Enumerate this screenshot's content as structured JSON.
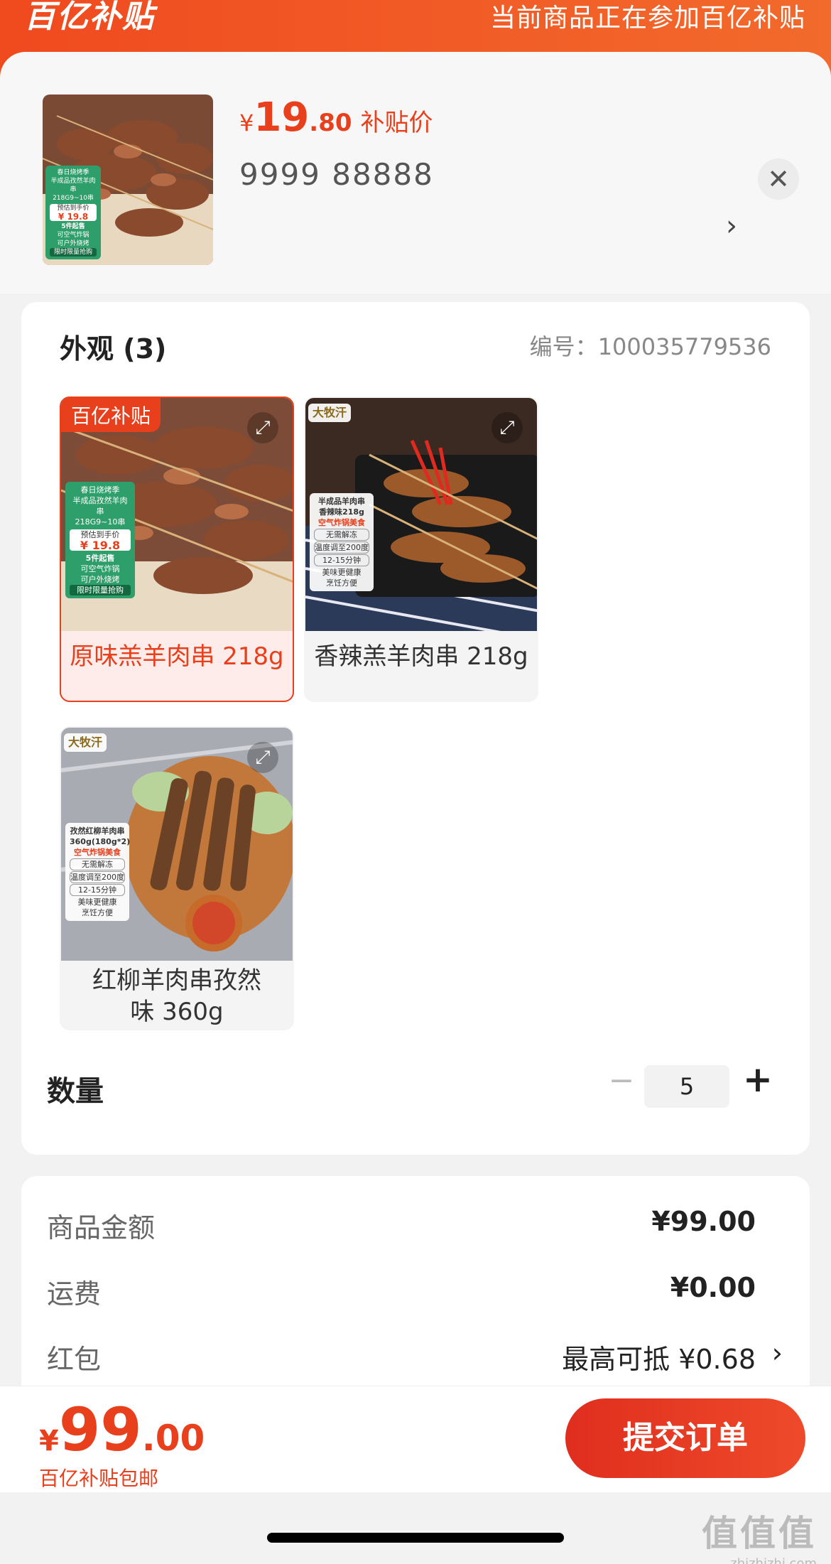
{
  "banner": {
    "logo": "百亿补贴",
    "text": "当前商品正在参加百亿补贴"
  },
  "product": {
    "price_currency": "¥",
    "price_int": "19",
    "price_dec": ".80",
    "price_tag": "补贴价",
    "code": "9999  88888",
    "close_icon": "close-icon",
    "more_icon": "chevron-right-icon",
    "thumb_text": {
      "line1": "春日烧烤季",
      "line2": "半成品孜然羊肉串",
      "line3": "218G9~10串",
      "price_label": "预估到手价",
      "price": "¥ 19.8",
      "min": "5件起售",
      "feature1": "可空气炸锅",
      "feature2": "可户外烧烤",
      "promo": "限时限量抢购"
    }
  },
  "options": {
    "title": "外观 (3)",
    "item_no_label": "编号：",
    "item_no": "100035779536",
    "items": [
      {
        "name": "原味羔羊肉串 218g",
        "badge": "百亿补贴",
        "selected": true,
        "card": [
          "春日烧烤季",
          "半成品孜然羊肉串",
          "218G9~10串",
          "预估到手价",
          "¥ 19.8",
          "5件起售",
          "可空气炸锅",
          "可户外烧烤",
          "限时限量抢购"
        ]
      },
      {
        "name": "香辣羔羊肉串 218g",
        "brand": "大牧汗",
        "card": [
          "半成品羊肉串",
          "香辣味218g",
          "空气炸锅美食",
          "无需解冻",
          "温度调至200度",
          "12-15分钟",
          "美味更健康",
          "烹饪方便"
        ]
      },
      {
        "name": "红柳羊肉串孜然味 360g",
        "brand": "大牧汗",
        "card": [
          "孜然红柳羊肉串",
          "360g(180g*2)",
          "空气炸锅美食",
          "无需解冻",
          "温度调至200度",
          "12-15分钟",
          "美味更健康",
          "烹饪方便"
        ]
      }
    ]
  },
  "quantity": {
    "label": "数量",
    "value": "5",
    "minus": "−",
    "plus": "+"
  },
  "summary": {
    "goods_label": "商品金额",
    "goods_value": "¥99.00",
    "shipping_label": "运费",
    "shipping_value": "¥0.00",
    "redpacket_label": "红包",
    "redpacket_value": "最高可抵 ¥0.68"
  },
  "footer": {
    "currency": "¥",
    "total_int": "99",
    "total_dec": ".00",
    "sub": "百亿补贴包邮",
    "submit": "提交订单"
  },
  "watermark": {
    "big": "值值值",
    "small": "zhizhizhi.com"
  },
  "colors": {
    "accent": "#e8401c",
    "banner": "#f04a1f"
  }
}
